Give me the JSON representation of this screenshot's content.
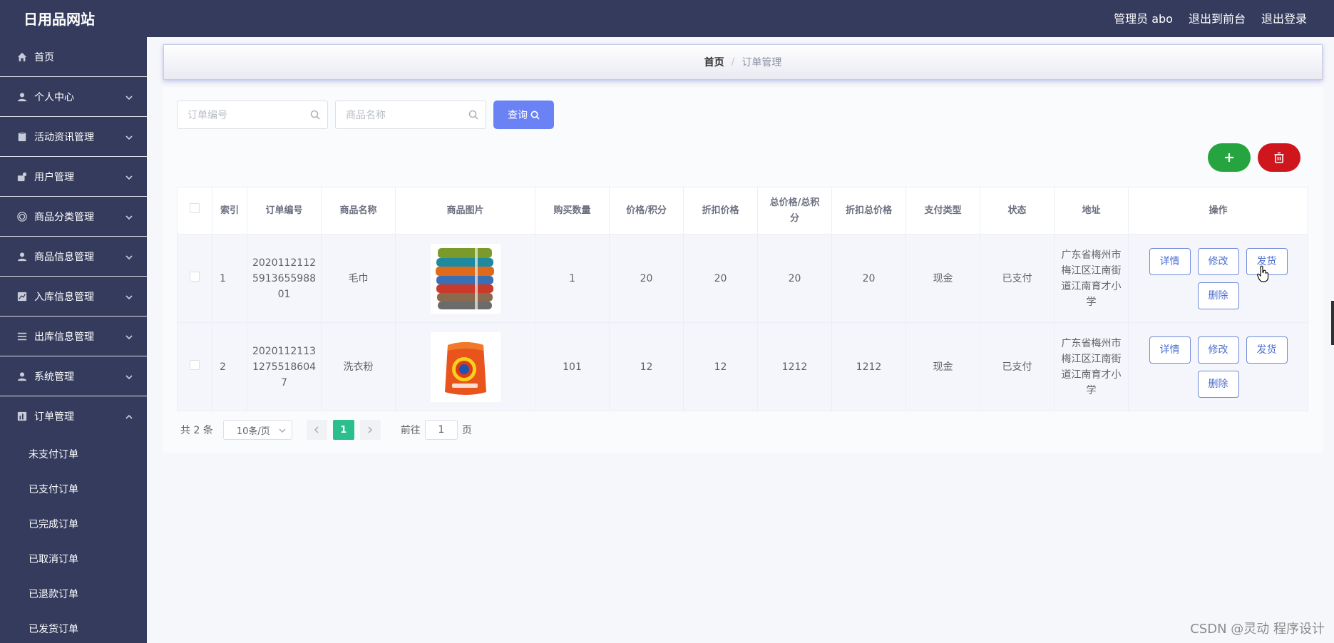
{
  "header": {
    "brand": "日用品网站",
    "admin_label": "管理员 abo",
    "to_frontend": "退出到前台",
    "logout": "退出登录"
  },
  "sidebar": {
    "items": [
      {
        "label": "首页",
        "icon": "home-icon",
        "expandable": false
      },
      {
        "label": "个人中心",
        "icon": "user-icon",
        "expandable": true
      },
      {
        "label": "活动资讯管理",
        "icon": "clipboard-icon",
        "expandable": true
      },
      {
        "label": "用户管理",
        "icon": "user-group-icon",
        "expandable": true
      },
      {
        "label": "商品分类管理",
        "icon": "category-icon",
        "expandable": true
      },
      {
        "label": "商品信息管理",
        "icon": "user-icon",
        "expandable": true
      },
      {
        "label": "入库信息管理",
        "icon": "chart-icon",
        "expandable": true
      },
      {
        "label": "出库信息管理",
        "icon": "list-icon",
        "expandable": true
      },
      {
        "label": "系统管理",
        "icon": "user-icon",
        "expandable": true
      },
      {
        "label": "订单管理",
        "icon": "bar-chart-icon",
        "expandable": true,
        "expanded": true
      }
    ],
    "sub_items": [
      "未支付订单",
      "已支付订单",
      "已完成订单",
      "已取消订单",
      "已退款订单",
      "已发货订单"
    ]
  },
  "breadcrumb": {
    "home": "首页",
    "separator": "/",
    "current": "订单管理"
  },
  "search": {
    "order_no_placeholder": "订单编号",
    "product_name_placeholder": "商品名称",
    "query_label": "查询"
  },
  "table": {
    "headers": [
      "索引",
      "订单编号",
      "商品名称",
      "商品图片",
      "购买数量",
      "价格/积分",
      "折扣价格",
      "总价格/总积分",
      "折扣总价格",
      "支付类型",
      "状态",
      "地址",
      "操作"
    ],
    "rows": [
      {
        "index": "1",
        "order_no": "20201121125913655988 01",
        "order_no_lines": [
          "2020112112",
          "5913655988",
          "01"
        ],
        "product_name": "毛巾",
        "image": "towels",
        "quantity": "1",
        "price": "20",
        "discount_price": "20",
        "total_price": "20",
        "discount_total": "20",
        "pay_type": "现金",
        "status": "已支付",
        "address_lines": [
          "广东省梅州市",
          "梅江区江南街",
          "道江南育才小",
          "学"
        ]
      },
      {
        "index": "2",
        "order_no": "20201121131275518604 7",
        "order_no_lines": [
          "2020112113",
          "1275518604",
          "7"
        ],
        "product_name": "洗衣粉",
        "image": "detergent",
        "quantity": "101",
        "price": "12",
        "discount_price": "12",
        "total_price": "1212",
        "discount_total": "1212",
        "pay_type": "现金",
        "status": "已支付",
        "address_lines": [
          "广东省梅州市",
          "梅江区江南街",
          "道江南育才小",
          "学"
        ]
      }
    ],
    "actions": {
      "detail": "详情",
      "edit": "修改",
      "ship": "发货",
      "delete": "删除"
    }
  },
  "pagination": {
    "total": "共 2 条",
    "page_size": "10条/页",
    "current_page": "1",
    "goto_prefix": "前往",
    "goto_value": "1",
    "goto_suffix": "页"
  },
  "watermark": "CSDN @灵动 程序设计",
  "colors": {
    "sidebar_bg": "#353b5c",
    "accent_blue": "#6b82f5",
    "add_green": "#26a43f",
    "delete_red": "#d0161d",
    "page_active": "#2bbf8e"
  }
}
